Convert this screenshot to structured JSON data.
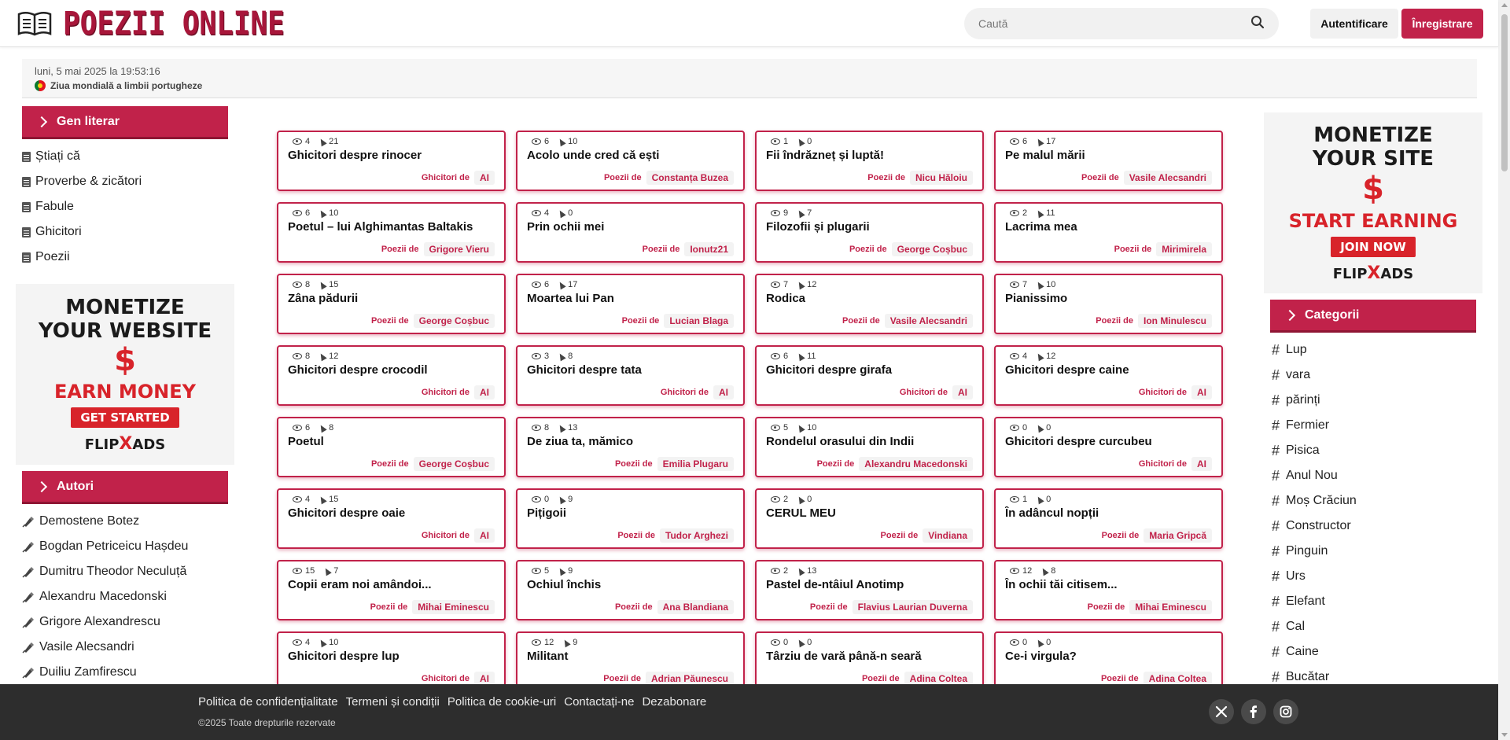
{
  "header": {
    "logo_text": "POEZII ONLINE",
    "search_placeholder": "Caută",
    "login_label": "Autentificare",
    "register_label": "Înregistrare"
  },
  "datebar": {
    "date": "luni, 5 mai 2025 la 19:53:16",
    "event": "Ziua mondială a limbii portugheze"
  },
  "left_sidebar": {
    "gen_title": "Gen literar",
    "gen_items": [
      {
        "label": "Știați că"
      },
      {
        "label": "Proverbe & zicători"
      },
      {
        "label": "Fabule"
      },
      {
        "label": "Ghicitori"
      },
      {
        "label": "Poezii"
      }
    ],
    "ad": {
      "line1": "MONETIZE",
      "line2": "YOUR WEBSITE",
      "symbol": "$",
      "earn": "EARN MONEY",
      "cta": "GET STARTED",
      "brand1": "FLIP",
      "brand_x": "X",
      "brand2": "ADS"
    },
    "autori_title": "Autori",
    "autori": [
      {
        "label": "Demostene Botez"
      },
      {
        "label": "Bogdan Petriceicu Hașdeu"
      },
      {
        "label": "Dumitru Theodor Neculuță"
      },
      {
        "label": "Alexandru Macedonski"
      },
      {
        "label": "Grigore Alexandrescu"
      },
      {
        "label": "Vasile Alecsandri"
      },
      {
        "label": "Duiliu Zamfirescu"
      }
    ]
  },
  "right_sidebar": {
    "ad": {
      "line1": "MONETIZE",
      "line2": "YOUR SITE",
      "symbol": "$",
      "earn": "START EARNING",
      "cta": "JOIN NOW",
      "brand1": "FLIP",
      "brand_x": "X",
      "brand2": "ADS"
    },
    "categorii_title": "Categorii",
    "categorii": [
      {
        "label": "Lup"
      },
      {
        "label": "vara"
      },
      {
        "label": "părinți"
      },
      {
        "label": "Fermier"
      },
      {
        "label": "Pisica"
      },
      {
        "label": "Anul Nou"
      },
      {
        "label": "Moș Crăciun"
      },
      {
        "label": "Constructor"
      },
      {
        "label": "Pinguin"
      },
      {
        "label": "Urs"
      },
      {
        "label": "Elefant"
      },
      {
        "label": "Cal"
      },
      {
        "label": "Caine"
      },
      {
        "label": "Bucătar"
      }
    ]
  },
  "cards": [
    {
      "views": "4",
      "clicks": "21",
      "title": "Ghicitori despre rinocer",
      "type": "Ghicitori de",
      "author": "AI"
    },
    {
      "views": "6",
      "clicks": "10",
      "title": "Acolo unde cred că ești",
      "type": "Poezii de",
      "author": "Constanța Buzea"
    },
    {
      "views": "1",
      "clicks": "0",
      "title": "Fii îndrăzneț și luptă!",
      "type": "Poezii de",
      "author": "Nicu Hăloiu"
    },
    {
      "views": "6",
      "clicks": "17",
      "title": "Pe malul mării",
      "type": "Poezii de",
      "author": "Vasile Alecsandri"
    },
    {
      "views": "6",
      "clicks": "10",
      "title": "Poetul – lui Alghimantas Baltakis",
      "type": "Poezii de",
      "author": "Grigore Vieru"
    },
    {
      "views": "4",
      "clicks": "0",
      "title": "Prin ochii mei",
      "type": "Poezii de",
      "author": "Ionutz21"
    },
    {
      "views": "9",
      "clicks": "7",
      "title": "Filozofii și plugarii",
      "type": "Poezii de",
      "author": "George Coșbuc"
    },
    {
      "views": "2",
      "clicks": "11",
      "title": "Lacrima mea",
      "type": "Poezii de",
      "author": "Mirimirela"
    },
    {
      "views": "8",
      "clicks": "15",
      "title": "Zâna pădurii",
      "type": "Poezii de",
      "author": "George Coșbuc"
    },
    {
      "views": "6",
      "clicks": "17",
      "title": "Moartea lui Pan",
      "type": "Poezii de",
      "author": "Lucian Blaga"
    },
    {
      "views": "7",
      "clicks": "12",
      "title": "Rodica",
      "type": "Poezii de",
      "author": "Vasile Alecsandri"
    },
    {
      "views": "7",
      "clicks": "10",
      "title": "Pianissimo",
      "type": "Poezii de",
      "author": "Ion Minulescu"
    },
    {
      "views": "8",
      "clicks": "12",
      "title": "Ghicitori despre crocodil",
      "type": "Ghicitori de",
      "author": "AI"
    },
    {
      "views": "3",
      "clicks": "8",
      "title": "Ghicitori despre tata",
      "type": "Ghicitori de",
      "author": "AI"
    },
    {
      "views": "6",
      "clicks": "11",
      "title": "Ghicitori despre girafa",
      "type": "Ghicitori de",
      "author": "AI"
    },
    {
      "views": "4",
      "clicks": "12",
      "title": "Ghicitori despre caine",
      "type": "Ghicitori de",
      "author": "AI"
    },
    {
      "views": "6",
      "clicks": "8",
      "title": "Poetul",
      "type": "Poezii de",
      "author": "George Coșbuc"
    },
    {
      "views": "8",
      "clicks": "13",
      "title": "De ziua ta, mămico",
      "type": "Poezii de",
      "author": "Emilia Plugaru"
    },
    {
      "views": "5",
      "clicks": "10",
      "title": "Rondelul orasului din Indii",
      "type": "Poezii de",
      "author": "Alexandru Macedonski"
    },
    {
      "views": "0",
      "clicks": "0",
      "title": "Ghicitori despre curcubeu",
      "type": "Ghicitori de",
      "author": "AI"
    },
    {
      "views": "4",
      "clicks": "15",
      "title": "Ghicitori despre oaie",
      "type": "Ghicitori de",
      "author": "AI"
    },
    {
      "views": "0",
      "clicks": "9",
      "title": "Pițigoii",
      "type": "Poezii de",
      "author": "Tudor Arghezi"
    },
    {
      "views": "2",
      "clicks": "0",
      "title": "CERUL MEU",
      "type": "Poezii de",
      "author": "Vindiana"
    },
    {
      "views": "1",
      "clicks": "0",
      "title": "În adâncul nopții",
      "type": "Poezii de",
      "author": "Maria Gripcă"
    },
    {
      "views": "15",
      "clicks": "7",
      "title": "Copii eram noi amândoi...",
      "type": "Poezii de",
      "author": "Mihai Eminescu"
    },
    {
      "views": "5",
      "clicks": "9",
      "title": "Ochiul închis",
      "type": "Poezii de",
      "author": "Ana Blandiana"
    },
    {
      "views": "2",
      "clicks": "13",
      "title": "Pastel de-ntâiul Anotimp",
      "type": "Poezii de",
      "author": "Flavius Laurian Duverna"
    },
    {
      "views": "12",
      "clicks": "8",
      "title": "În ochii tăi citisem...",
      "type": "Poezii de",
      "author": "Mihai Eminescu"
    },
    {
      "views": "4",
      "clicks": "10",
      "title": "Ghicitori despre lup",
      "type": "Ghicitori de",
      "author": "AI"
    },
    {
      "views": "12",
      "clicks": "9",
      "title": "Militant",
      "type": "Poezii de",
      "author": "Adrian Păunescu"
    },
    {
      "views": "0",
      "clicks": "0",
      "title": "Târziu de vară până-n seară",
      "type": "Poezii de",
      "author": "Adina Coltea"
    },
    {
      "views": "0",
      "clicks": "0",
      "title": "Ce-i virgula?",
      "type": "Poezii de",
      "author": "Adina Coltea"
    }
  ],
  "footer": {
    "links": [
      {
        "label": "Politica de confidențialitate"
      },
      {
        "label": "Termeni și condiții"
      },
      {
        "label": "Politica de cookie-uri"
      },
      {
        "label": "Contactați-ne"
      },
      {
        "label": "Dezabonare"
      }
    ],
    "copyright": "©2025 Toate drepturile rezervate",
    "social": [
      "x-icon",
      "facebook-icon",
      "instagram-icon"
    ]
  },
  "colors": {
    "accent": "#c1224a",
    "footer_bg": "#2d2d2d"
  }
}
